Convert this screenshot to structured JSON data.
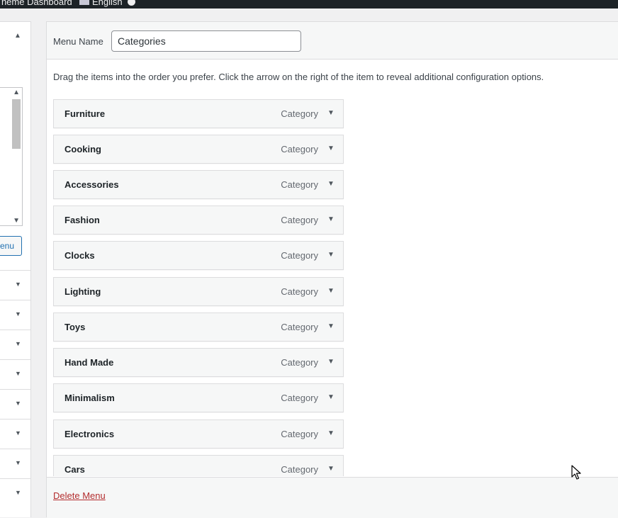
{
  "adminbar": {
    "site_label": "Theme Dashboard",
    "language_label": "English"
  },
  "left_panel": {
    "add_button_label": "Add to Menu"
  },
  "menu_header": {
    "name_label": "Menu Name",
    "name_value": "Categories"
  },
  "instructions": "Drag the items into the order you prefer. Click the arrow on the right of the item to reveal additional configuration options.",
  "menu_items": [
    {
      "title": "Furniture",
      "type": "Category"
    },
    {
      "title": "Cooking",
      "type": "Category"
    },
    {
      "title": "Accessories",
      "type": "Category"
    },
    {
      "title": "Fashion",
      "type": "Category"
    },
    {
      "title": "Clocks",
      "type": "Category"
    },
    {
      "title": "Lighting",
      "type": "Category"
    },
    {
      "title": "Toys",
      "type": "Category"
    },
    {
      "title": "Hand Made",
      "type": "Category"
    },
    {
      "title": "Minimalism",
      "type": "Category"
    },
    {
      "title": "Electronics",
      "type": "Category"
    },
    {
      "title": "Cars",
      "type": "Category"
    }
  ],
  "footer": {
    "delete_label": "Delete Menu"
  },
  "icons": {
    "toggle": "triangle-down-icon",
    "cursor": "mouse-pointer-icon"
  }
}
